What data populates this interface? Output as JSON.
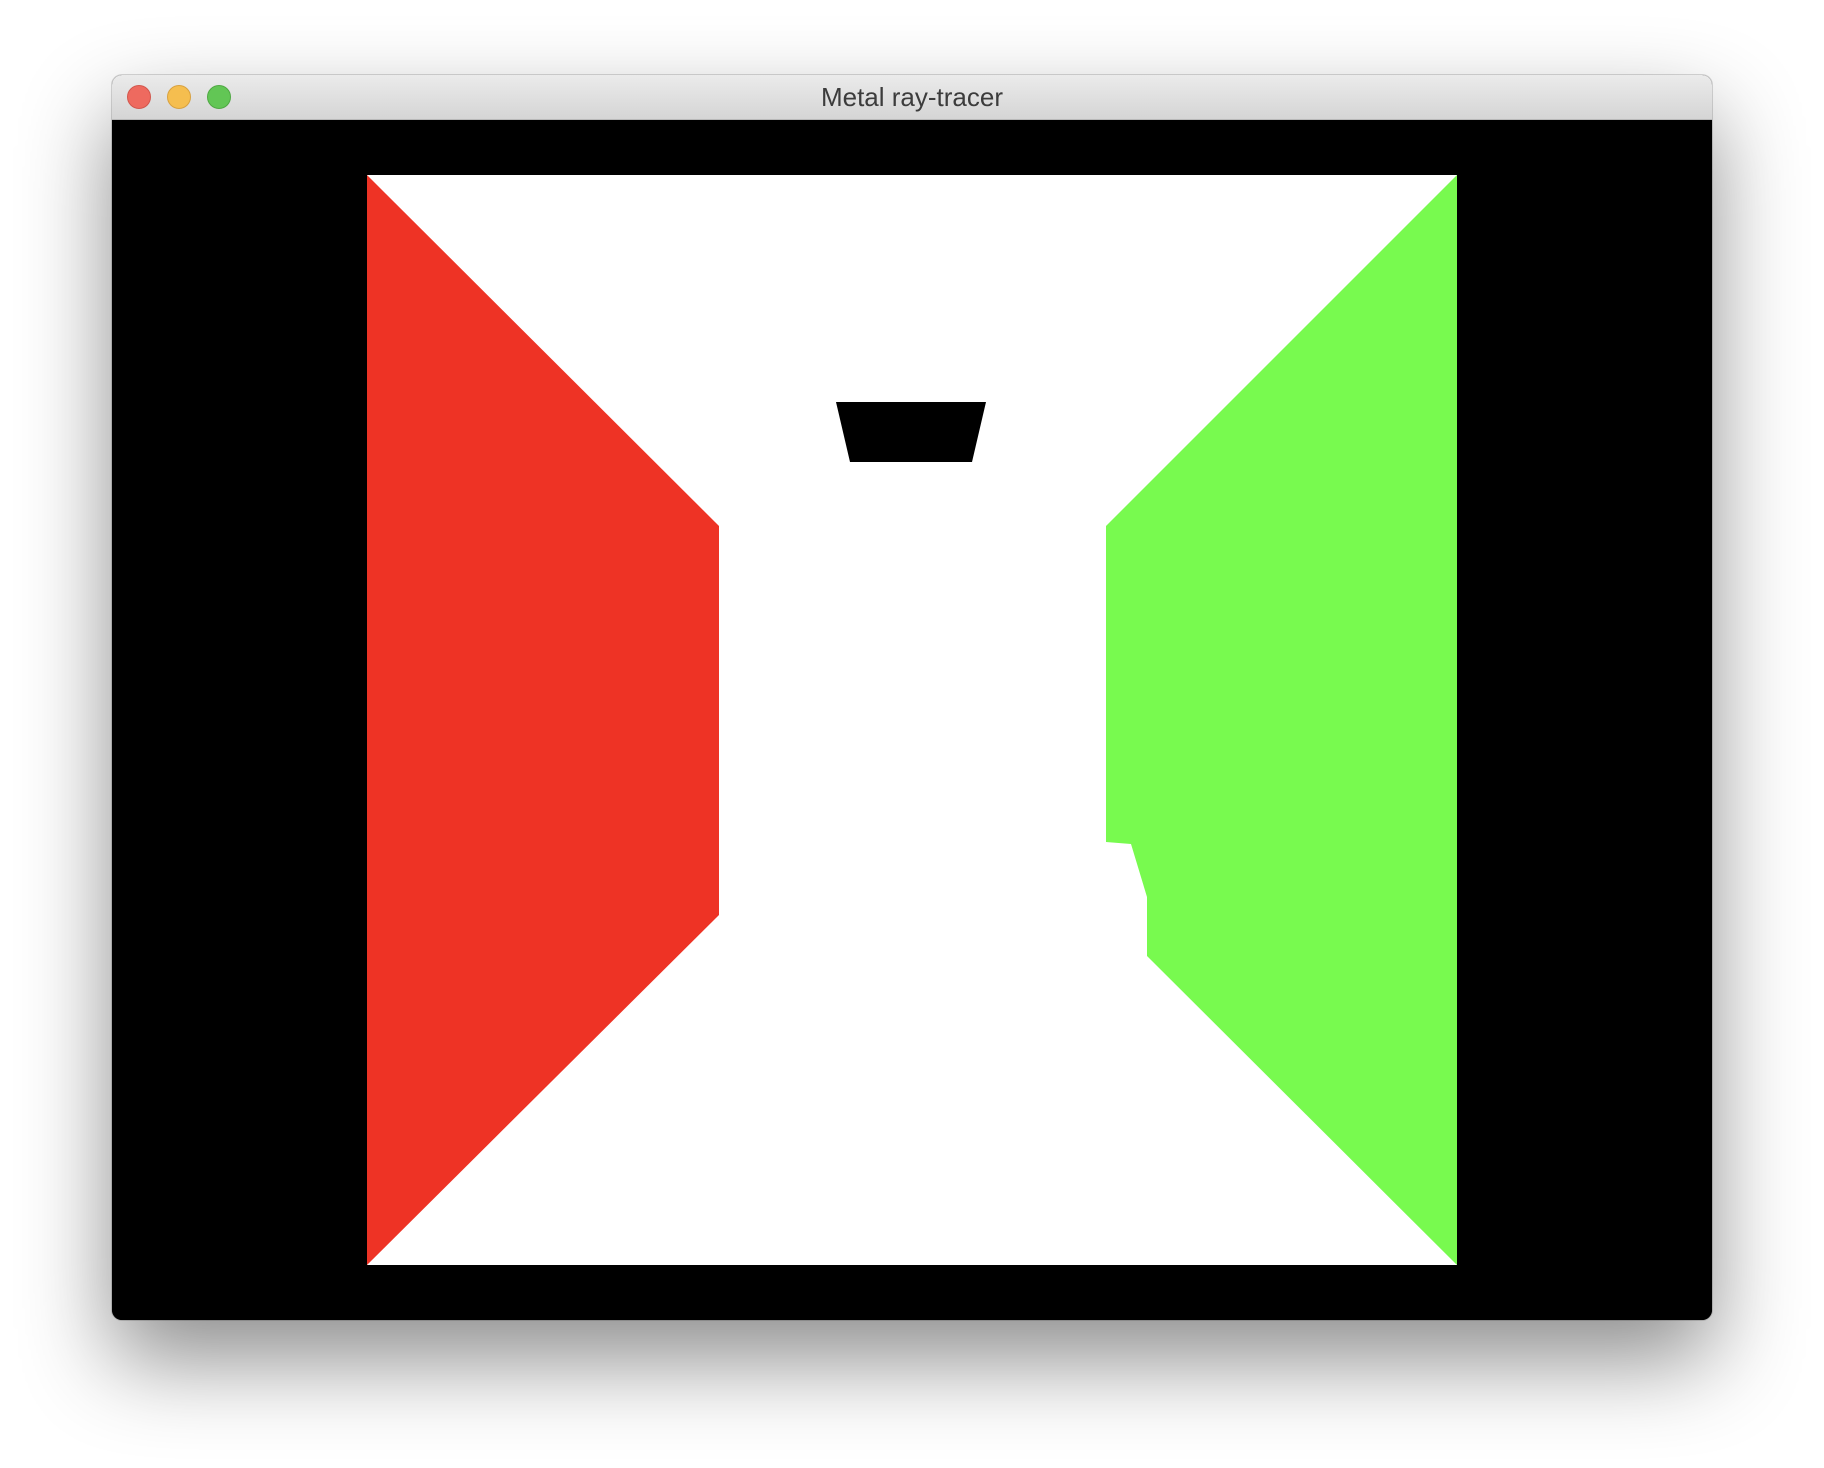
{
  "window": {
    "title": "Metal ray-tracer"
  },
  "render": {
    "left_wall_color": "#EE3325",
    "right_wall_color": "#78FA4F",
    "white_surface_color": "#FFFFFF",
    "background_color": "#000000"
  }
}
